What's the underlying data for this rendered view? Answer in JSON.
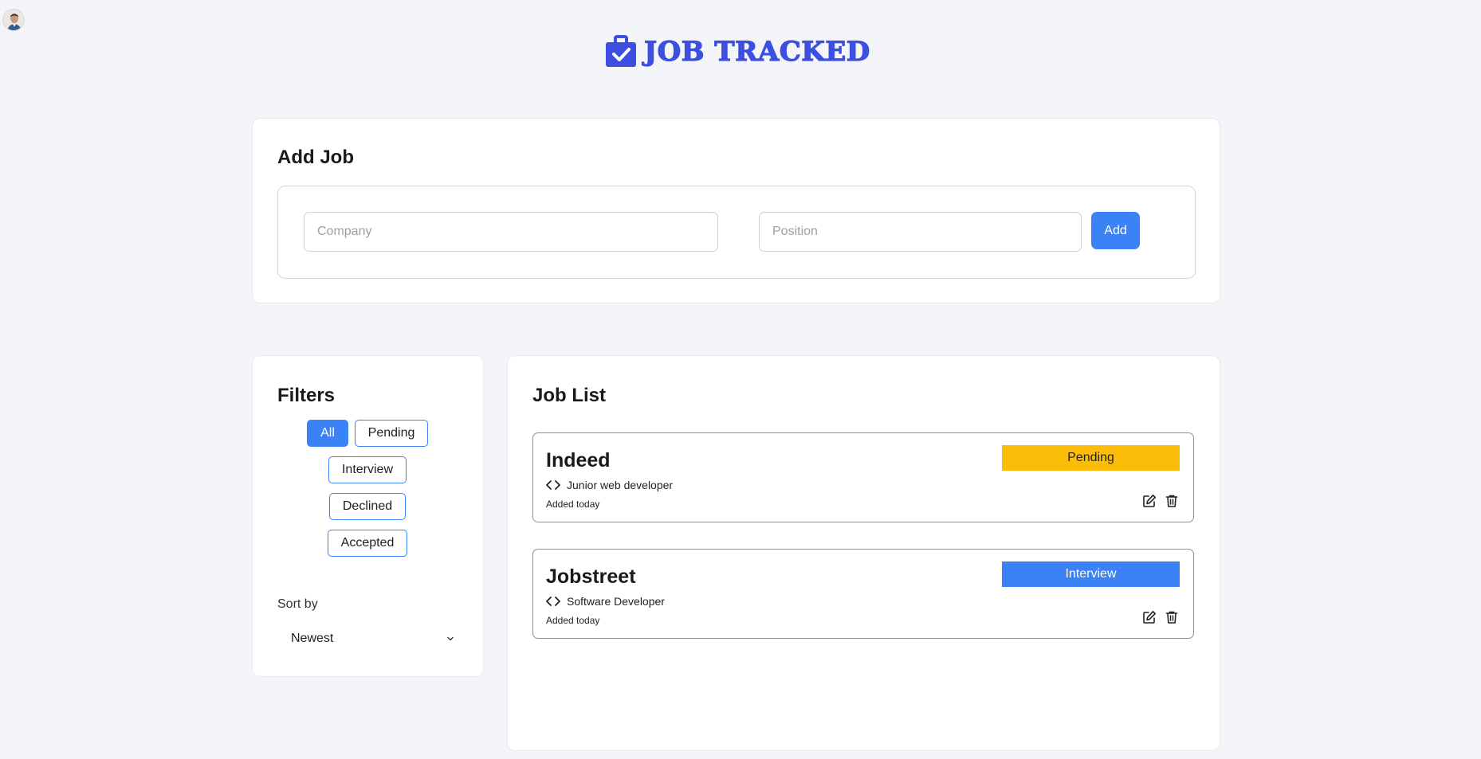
{
  "app": {
    "title": "JOB TRACKED",
    "avatar_icon": "user-avatar",
    "logo_icon": "briefcase-check-icon",
    "accent_color": "#3b82f6",
    "logo_color": "#3d4fe0"
  },
  "add_job": {
    "title": "Add Job",
    "company_placeholder": "Company",
    "company_value": "",
    "position_placeholder": "Position",
    "position_value": "",
    "add_label": "Add"
  },
  "filters": {
    "title": "Filters",
    "chips": [
      "All",
      "Pending",
      "Interview",
      "Declined",
      "Accepted"
    ],
    "active": "All",
    "sort_label": "Sort by",
    "sort_value": "Newest"
  },
  "job_list": {
    "title": "Job List",
    "jobs": [
      {
        "company": "Indeed",
        "position": "Junior web developer",
        "added": "Added today",
        "status": "Pending",
        "status_color": "#fbbd08"
      },
      {
        "company": "Jobstreet",
        "position": "Software Developer",
        "added": "Added today",
        "status": "Interview",
        "status_color": "#3b82f6"
      }
    ]
  }
}
